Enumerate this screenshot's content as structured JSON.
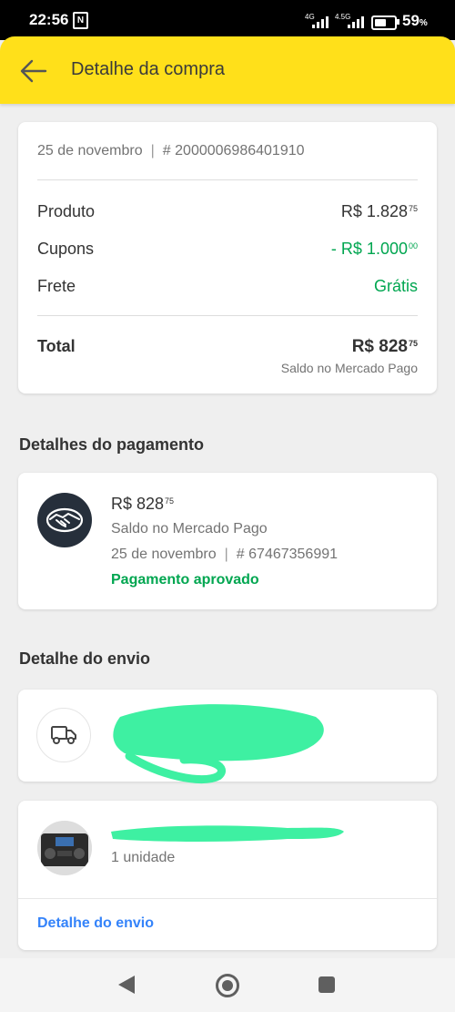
{
  "status_bar": {
    "time": "22:56",
    "nfc_glyph": "N",
    "network_1": "4G",
    "network_2": "4.5G",
    "battery_pct": "59",
    "battery_unit": "%",
    "battery_level": 0.59
  },
  "header": {
    "title": "Detalhe da compra",
    "back_icon": "arrow-left-icon",
    "background_color": "#ffe01a"
  },
  "summary": {
    "date": "25 de novembro",
    "separator": "|",
    "order_id": "# 2000006986401910",
    "rows": [
      {
        "label": "Produto",
        "value": "R$ 1.828",
        "cents": "75"
      },
      {
        "label": "Cupons",
        "value": "- R$ 1.000",
        "cents": "00"
      },
      {
        "label": "Frete",
        "value": "Grátis"
      }
    ],
    "total_label": "Total",
    "total_value": "R$ 828",
    "total_cents": "75",
    "total_method": "Saldo no Mercado Pago"
  },
  "payment": {
    "section_title": "Detalhes do pagamento",
    "logo_icon": "mercado-pago-handshake-icon",
    "amount": "R$ 828",
    "amount_cents": "75",
    "method": "Saldo no Mercado Pago",
    "date": "25 de novembro",
    "separator": "|",
    "payment_id": "# 67467356991",
    "status": "Pagamento aprovado"
  },
  "shipping": {
    "section_title": "Detalhe do envio",
    "truck_icon": "truck-icon"
  },
  "product": {
    "quantity": "1 unidade",
    "link_label": "Detalhe do envio"
  },
  "colors": {
    "accent_yellow": "#ffe01a",
    "success_green": "#00a650",
    "link_blue": "#3483fa",
    "redaction": "#3ef0a2"
  },
  "nav_bar": {
    "back_icon": "triangle-back-icon",
    "home_icon": "circle-home-icon",
    "recent_icon": "square-recents-icon"
  }
}
